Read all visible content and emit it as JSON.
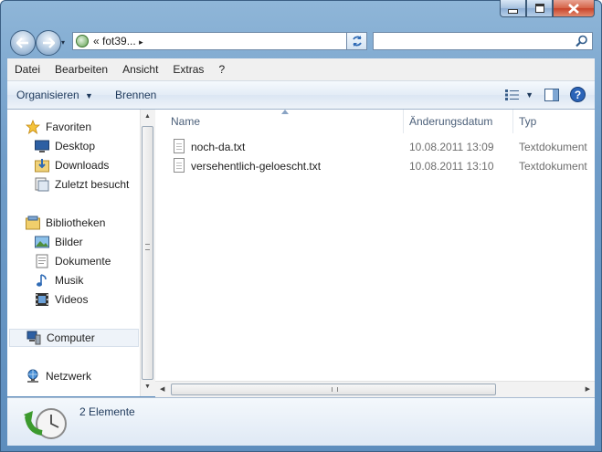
{
  "window": {
    "address": {
      "chevron": "«",
      "path": "fot39...",
      "arrow": "▸"
    },
    "search_placeholder": ""
  },
  "menu": [
    "Datei",
    "Bearbeiten",
    "Ansicht",
    "Extras",
    "?"
  ],
  "commandbar": {
    "organize": "Organisieren",
    "burn": "Brennen"
  },
  "nav": {
    "favorites": {
      "label": "Favoriten",
      "items": [
        "Desktop",
        "Downloads",
        "Zuletzt besucht"
      ]
    },
    "libraries": {
      "label": "Bibliotheken",
      "items": [
        "Bilder",
        "Dokumente",
        "Musik",
        "Videos"
      ]
    },
    "computer": "Computer",
    "network": "Netzwerk"
  },
  "columns": {
    "name": "Name",
    "date": "Änderungsdatum",
    "type": "Typ"
  },
  "files": [
    {
      "name": "noch-da.txt",
      "date": "10.08.2011 13:09",
      "type": "Textdokument"
    },
    {
      "name": "versehentlich-geloescht.txt",
      "date": "10.08.2011 13:10",
      "type": "Textdokument"
    }
  ],
  "status": {
    "count": "2 Elemente"
  },
  "colors": {
    "accent": "#1e395b",
    "frame": "#6f9cc8",
    "close": "#c7432a"
  }
}
